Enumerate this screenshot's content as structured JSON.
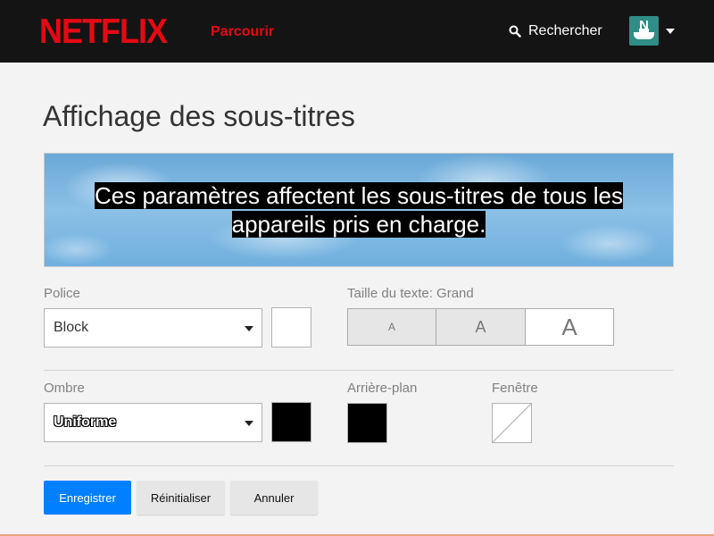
{
  "header": {
    "logo": "NETFLIX",
    "browse_label": "Parcourir",
    "search_label": "Recherche",
    "search_label_full": "Rechercher",
    "avatar_letter": "N",
    "colors": {
      "brand": "#e50914",
      "bar": "#141414"
    }
  },
  "page": {
    "title": "Affichage des sous-titres",
    "preview_text": "Ces paramètres affectent les sous-titres de tous les appareils pris en charge."
  },
  "font": {
    "label": "Police",
    "selected": "Block",
    "color": "#ffffff"
  },
  "text_size": {
    "label": "Taille du texte: Grand",
    "options": [
      "A",
      "A",
      "A"
    ],
    "selected_index": 2
  },
  "shadow": {
    "label": "Ombre",
    "selected": "Uniforme",
    "color": "#000000"
  },
  "background": {
    "label": "Arrière-plan",
    "color": "#000000"
  },
  "window": {
    "label": "Fenêtre",
    "color": "none"
  },
  "actions": {
    "save": "Enregistrer",
    "reset": "Réinitialiser",
    "cancel": "Annuler"
  }
}
